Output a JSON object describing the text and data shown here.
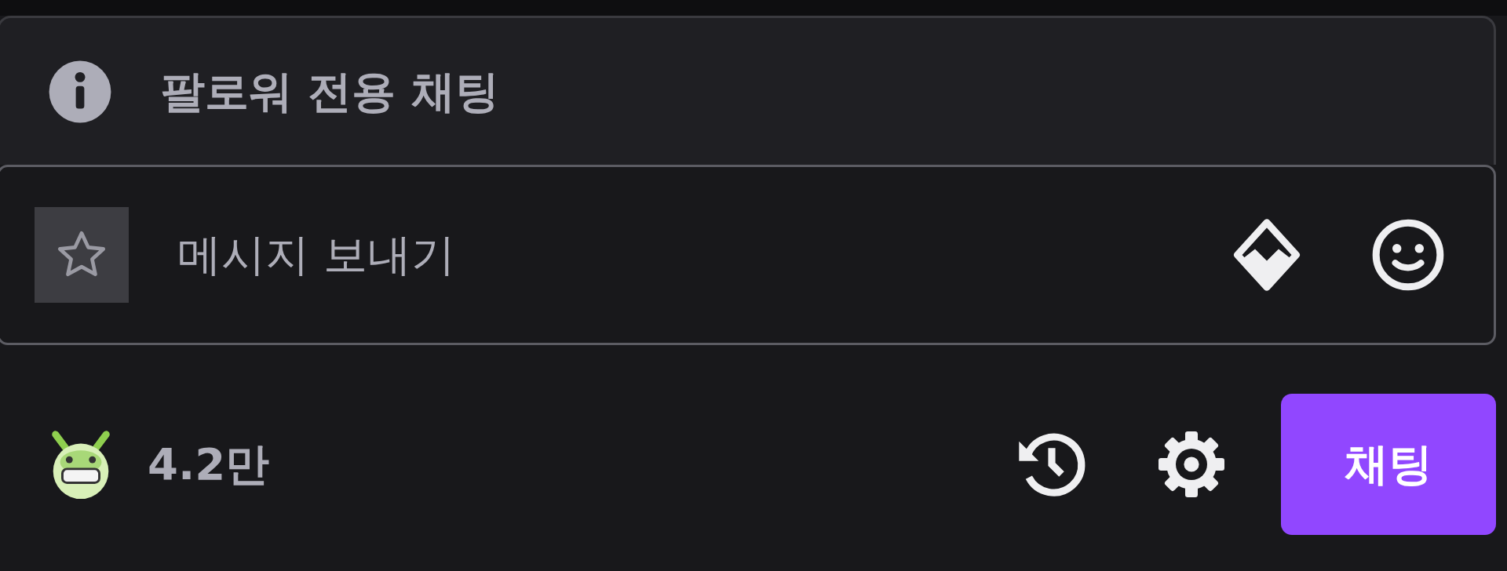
{
  "notice": {
    "text": "팔로워 전용 채팅"
  },
  "message_input": {
    "placeholder": "메시지 보내기"
  },
  "channel_points": {
    "count": "4.2만"
  },
  "chat_button": {
    "label": "채팅"
  }
}
